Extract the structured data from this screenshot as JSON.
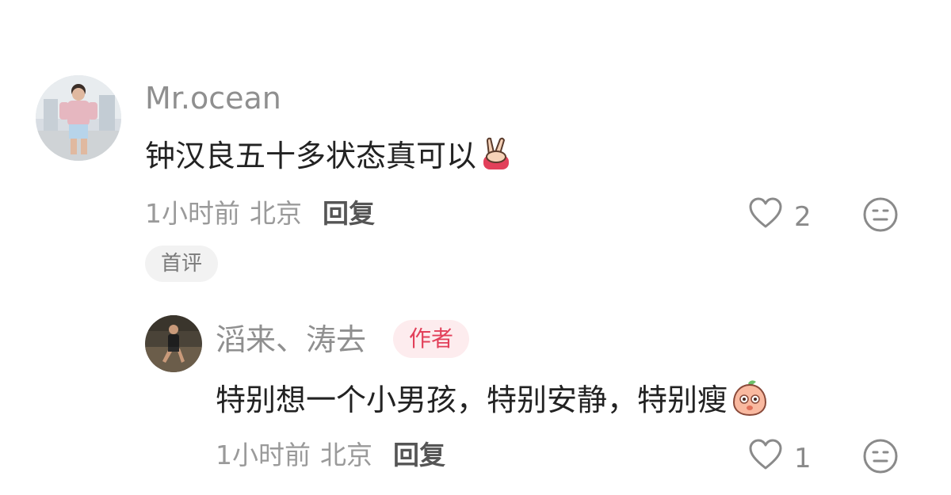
{
  "comment": {
    "username": "Mr.ocean",
    "text": "钟汉良五十多状态真可以",
    "emoji": "victory-hand-emoji",
    "time": "1小时前",
    "location": "北京",
    "reply_label": "回复",
    "likes": "2",
    "badge": "首评"
  },
  "reply": {
    "username": "滔来、涛去",
    "author_badge": "作者",
    "text": "特别想一个小男孩，特别安静，特别瘦",
    "emoji": "peach-face-emoji",
    "time": "1小时前",
    "location": "北京",
    "reply_label": "回复",
    "likes": "1"
  },
  "colors": {
    "accent": "#e2405a",
    "username": "#8f8f8f",
    "text": "#222222",
    "meta": "#9a9a9a"
  }
}
